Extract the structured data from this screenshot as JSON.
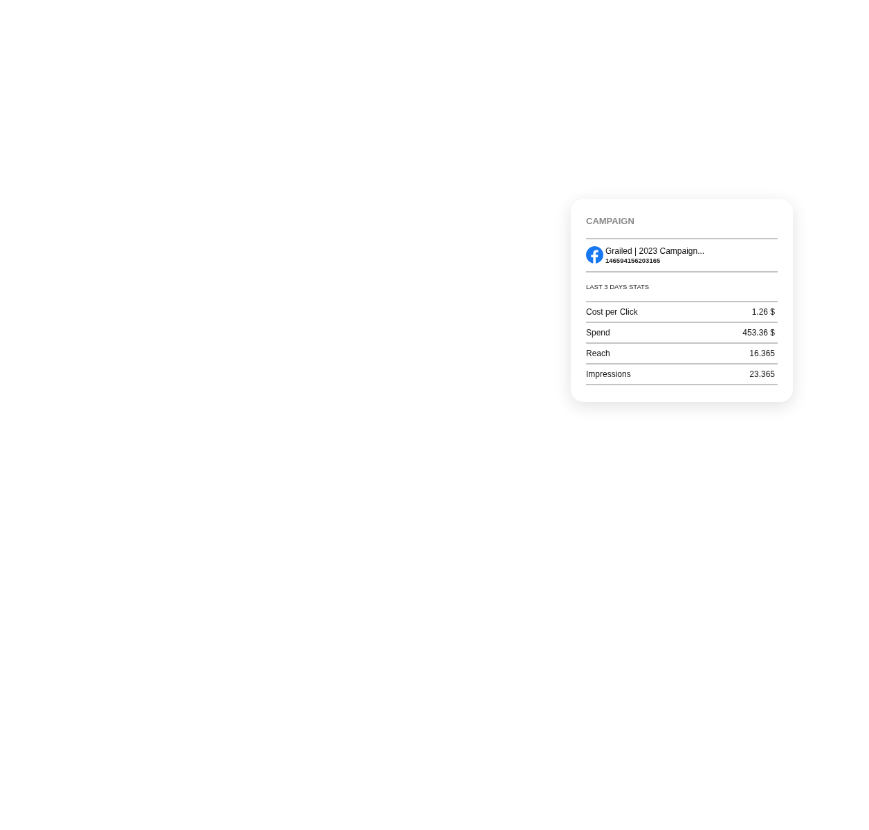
{
  "card": {
    "title": "CAMPAIGN",
    "campaign": {
      "name": "Grailed | 2023 Campaign...",
      "id": "146594156203165"
    },
    "stats_heading": "LAST 3 DAYS STATS",
    "stats": [
      {
        "label": "Cost per Click",
        "value": "1.26 $"
      },
      {
        "label": "Spend",
        "value": "453.36 $"
      },
      {
        "label": "Reach",
        "value": "16.365"
      },
      {
        "label": "Impressions",
        "value": "23.365"
      }
    ]
  }
}
